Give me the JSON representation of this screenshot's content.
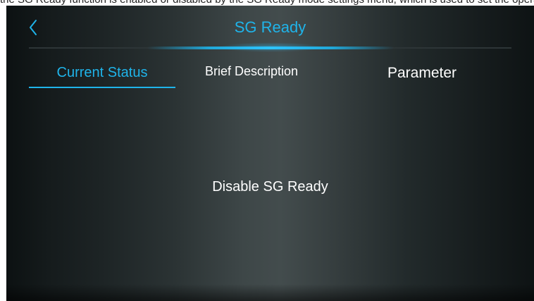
{
  "top_caption": "the SG Ready function is enabled or disabled by the SG Ready mode settings menu, which is used to set the operating mode of the unit",
  "header": {
    "title": "SG Ready",
    "back_icon": "chevron-left-icon"
  },
  "tabs": [
    {
      "label": "Current Status",
      "active": true
    },
    {
      "label": "Brief Description",
      "active": false
    },
    {
      "label": "Parameter",
      "active": false
    }
  ],
  "main": {
    "status_text": "Disable SG Ready"
  },
  "colors": {
    "accent": "#1fb4ea",
    "text": "#ffffff",
    "background_dark": "#0e1314",
    "background_center": "#434c4d"
  }
}
